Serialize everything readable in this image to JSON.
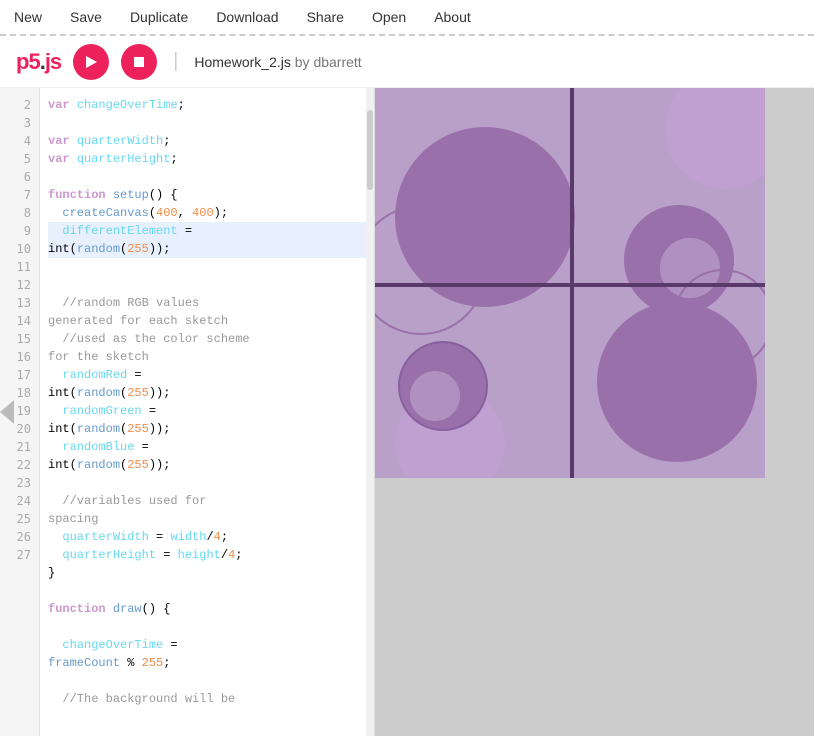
{
  "nav": {
    "items": [
      {
        "label": "New"
      },
      {
        "label": "Save"
      },
      {
        "label": "Duplicate"
      },
      {
        "label": "Download"
      },
      {
        "label": "Share"
      },
      {
        "label": "Open"
      },
      {
        "label": "About"
      }
    ]
  },
  "header": {
    "logo": "p5.js",
    "sketch_name": "Homework_2.js",
    "by_text": "by",
    "author": "dbarrett"
  },
  "editor": {
    "lines": [
      {
        "num": "2",
        "content": "var changeOverTime;"
      },
      {
        "num": "3",
        "content": ""
      },
      {
        "num": "4",
        "content": "var quarterWidth;"
      },
      {
        "num": "5",
        "content": "var quarterHeight;"
      },
      {
        "num": "6",
        "content": ""
      },
      {
        "num": "7",
        "content": "function setup() {"
      },
      {
        "num": "8",
        "content": "  createCanvas(400, 400);"
      },
      {
        "num": "9",
        "content": "  differentElement =\nint(random(255));"
      },
      {
        "num": "10",
        "content": ""
      },
      {
        "num": "11",
        "content": ""
      },
      {
        "num": "12",
        "content": "  //random RGB values\ngenerated for each sketch"
      },
      {
        "num": "13",
        "content": "  //used as the color scheme\nfor the sketch"
      },
      {
        "num": "14",
        "content": "  randomRed =\nint(random(255));"
      },
      {
        "num": "15",
        "content": "  randomGreen =\nint(random(255));"
      },
      {
        "num": "16",
        "content": "  randomBlue =\nint(random(255));"
      },
      {
        "num": "17",
        "content": ""
      },
      {
        "num": "18",
        "content": "  //variables used for\nspacing"
      },
      {
        "num": "19",
        "content": "  quarterWidth = width/4;"
      },
      {
        "num": "20",
        "content": "  quarterHeight = height/4;"
      },
      {
        "num": "21",
        "content": "}"
      },
      {
        "num": "22",
        "content": ""
      },
      {
        "num": "23",
        "content": "function draw() {"
      },
      {
        "num": "24",
        "content": ""
      },
      {
        "num": "25",
        "content": "  changeOverTime =\nframeCount % 255;"
      },
      {
        "num": "26",
        "content": ""
      },
      {
        "num": "27",
        "content": "  //The background will be"
      }
    ]
  }
}
